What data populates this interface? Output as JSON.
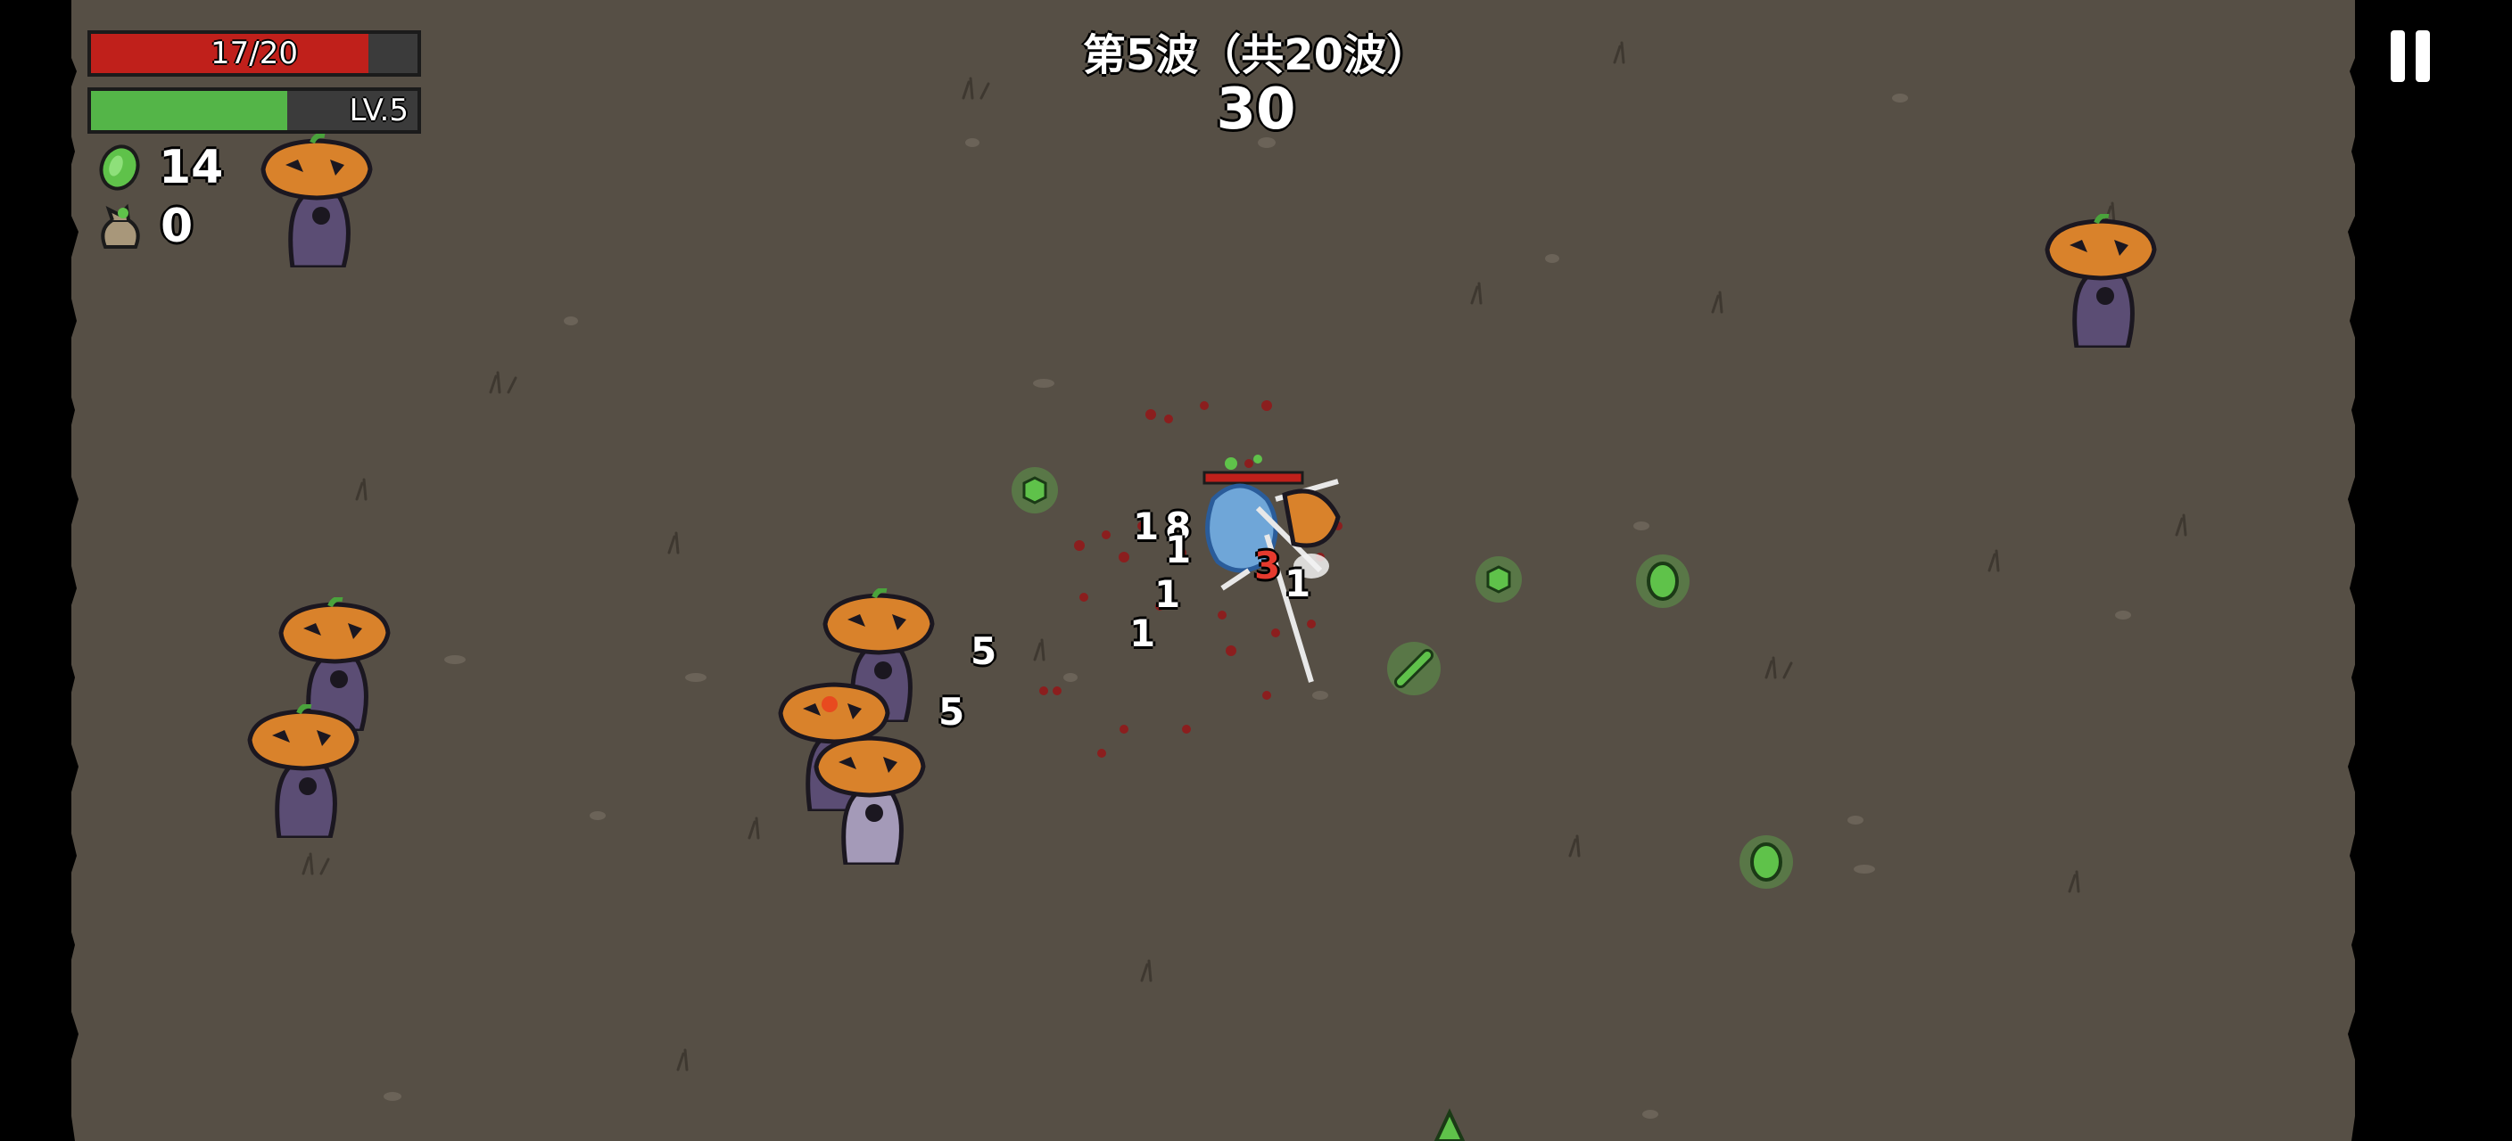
{
  "hud": {
    "hp_text": "17/20",
    "hp_fraction": 0.85,
    "xp_text": "LV.5",
    "xp_fraction": 0.6,
    "materials_count": "14",
    "bag_count": "0"
  },
  "wave": {
    "title": "第5波（共20波）",
    "timer": "30"
  },
  "damage_numbers": [
    "1",
    "8",
    "1",
    "1",
    "1",
    "5",
    "5",
    "3",
    "1"
  ],
  "colors": {
    "ground": "#564f45",
    "hp": "#c0201b",
    "xp": "#54b548",
    "material": "#5fc24a",
    "pumpkin": "#d9822b",
    "enemy_body": "#5b4d74"
  },
  "icons": {
    "materials": "green-material-icon",
    "bag": "loot-bag-icon",
    "pause": "pause-icon"
  }
}
